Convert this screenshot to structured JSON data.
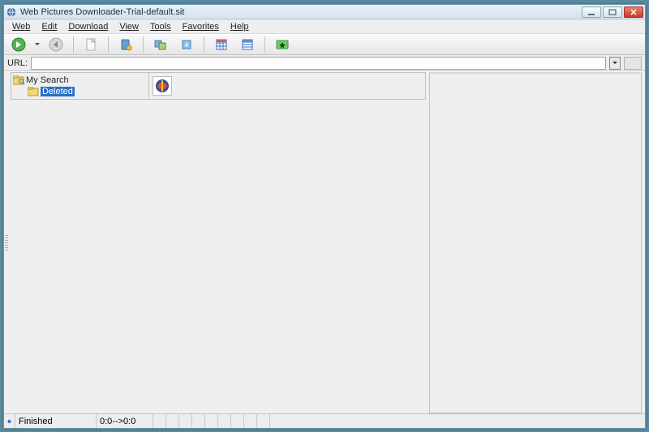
{
  "title": "Web Pictures Downloader-Trial-default.sit",
  "menu": {
    "items": [
      "Web",
      "Edit",
      "Download",
      "View",
      "Tools",
      "Favorites",
      "Help"
    ]
  },
  "toolbar": {
    "go": "go",
    "back": "back",
    "doc": "doc",
    "app": "app",
    "imgs": "images",
    "dl": "download",
    "cal1": "calendar",
    "cal2": "calendar2",
    "star": "favorite"
  },
  "url": {
    "label": "URL:",
    "value": ""
  },
  "tree": {
    "root": "My Search",
    "child": "Deleted"
  },
  "status": {
    "message": "Finished",
    "time": "0:0-->0:0"
  }
}
